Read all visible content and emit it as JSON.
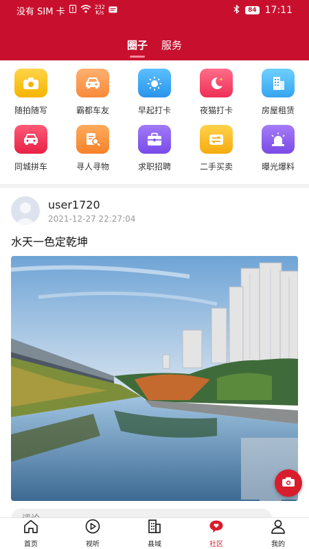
{
  "status_bar": {
    "carrier": "没有 SIM 卡",
    "net_speed_value": "232",
    "net_speed_unit": "K/s",
    "battery": "84",
    "time": "17:11"
  },
  "header": {
    "tabs": [
      {
        "label": "圈子",
        "active": true
      },
      {
        "label": "服务",
        "active": false
      }
    ],
    "accent_color": "#c8102e"
  },
  "categories": [
    {
      "label": "随拍随写",
      "icon": "camera-icon",
      "color": "#f7c21c"
    },
    {
      "label": "霸都车友",
      "icon": "car-icon",
      "color": "#f79a4d"
    },
    {
      "label": "早起打卡",
      "icon": "sun-icon",
      "color": "#3aa8f2"
    },
    {
      "label": "夜猫打卡",
      "icon": "moon-icon",
      "color": "#f5456b"
    },
    {
      "label": "房屋租赁",
      "icon": "building-icon",
      "color": "#4fb8f5"
    },
    {
      "label": "同城拼车",
      "icon": "car-icon",
      "color": "#f23d5b"
    },
    {
      "label": "寻人寻物",
      "icon": "search-doc-icon",
      "color": "#f7923a"
    },
    {
      "label": "求职招聘",
      "icon": "briefcase-icon",
      "color": "#8a5ff0"
    },
    {
      "label": "二手买卖",
      "icon": "exchange-icon",
      "color": "#f7b81c"
    },
    {
      "label": "曝光爆料",
      "icon": "alarm-icon",
      "color": "#8c5cf2"
    }
  ],
  "post": {
    "username": "user1720",
    "timestamp": "2021-12-27 22:27:04",
    "title": "水天一色定乾坤",
    "comment_placeholder": "评论"
  },
  "bottom_nav": [
    {
      "label": "首页",
      "icon": "home-icon",
      "active": false
    },
    {
      "label": "视听",
      "icon": "play-icon",
      "active": false
    },
    {
      "label": "县域",
      "icon": "county-building-icon",
      "active": false
    },
    {
      "label": "社区",
      "icon": "community-chat-icon",
      "active": true
    },
    {
      "label": "我的",
      "icon": "profile-icon",
      "active": false
    }
  ]
}
